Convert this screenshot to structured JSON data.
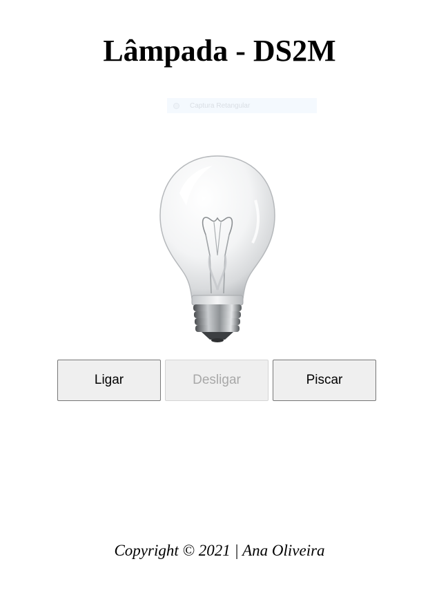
{
  "page": {
    "title": "Lâmpada - DS2M"
  },
  "snip_overlay": {
    "label": "Captura Retangular",
    "icon": "circle-icon"
  },
  "bulb": {
    "state": "off",
    "icon": "lightbulb-icon"
  },
  "buttons": {
    "ligar": {
      "label": "Ligar",
      "enabled": true
    },
    "desligar": {
      "label": "Desligar",
      "enabled": false
    },
    "piscar": {
      "label": "Piscar",
      "enabled": true
    }
  },
  "footer": {
    "text": "Copyright © 2021 | Ana Oliveira"
  },
  "colors": {
    "background": "#ffffff",
    "button_bg": "#efefef",
    "button_border": "#767676",
    "disabled_text": "#a8a8a8"
  }
}
